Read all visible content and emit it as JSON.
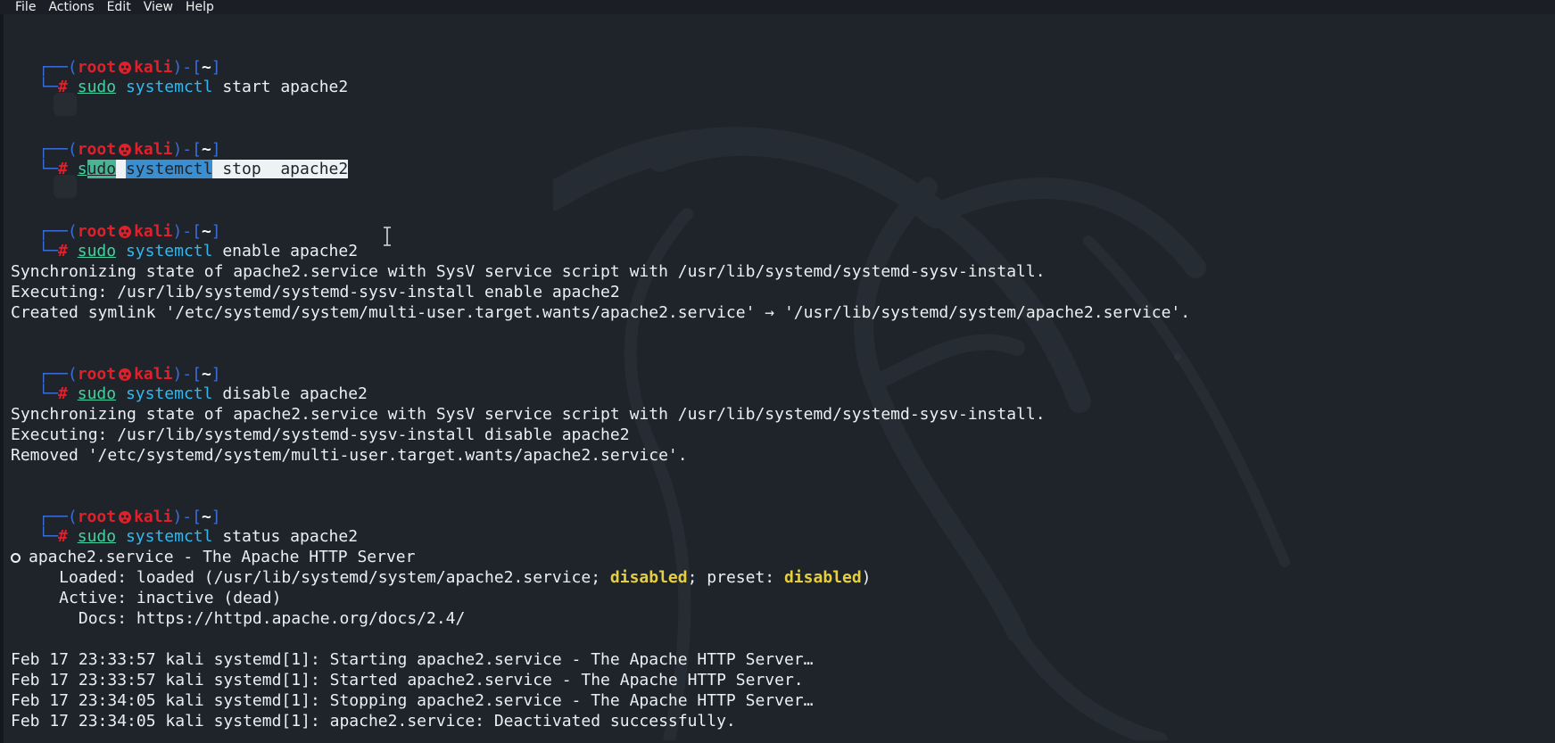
{
  "menu": [
    "File",
    "Actions",
    "Edit",
    "View",
    "Help"
  ],
  "prompt": {
    "open": "┌──(",
    "user": "root",
    "host": "kali",
    "mid": ")-[",
    "dir": "~",
    "close": "]",
    "corner": "└─",
    "hash": "#"
  },
  "blocks": [
    {
      "sudo": "sudo",
      "systemctl": "systemctl",
      "args": " start apache2"
    },
    {
      "sudo_s": "s",
      "sudo_rest": "udo",
      "systemctl": "systemctl",
      "args": " stop  apache2"
    },
    {
      "sudo": "sudo",
      "systemctl": "systemctl",
      "args": " enable apache2"
    },
    {
      "sudo": "sudo",
      "systemctl": "systemctl",
      "args": " disable apache2"
    },
    {
      "sudo": "sudo",
      "systemctl": "systemctl",
      "args": " status apache2"
    }
  ],
  "enable_output": [
    "Synchronizing state of apache2.service with SysV service script with /usr/lib/systemd/systemd-sysv-install.",
    "Executing: /usr/lib/systemd/systemd-sysv-install enable apache2",
    "Created symlink '/etc/systemd/system/multi-user.target.wants/apache2.service' → '/usr/lib/systemd/system/apache2.service'."
  ],
  "disable_output": [
    "Synchronizing state of apache2.service with SysV service script with /usr/lib/systemd/systemd-sysv-install.",
    "Executing: /usr/lib/systemd/systemd-sysv-install disable apache2",
    "Removed '/etc/systemd/system/multi-user.target.wants/apache2.service'."
  ],
  "status": {
    "header": "apache2.service - The Apache HTTP Server",
    "loaded_pre": "     Loaded: loaded (/usr/lib/systemd/system/apache2.service; ",
    "loaded_state": "disabled",
    "loaded_mid": "; preset: ",
    "preset_state": "disabled",
    "loaded_end": ")",
    "active": "     Active: inactive (dead)",
    "docs": "       Docs: https://httpd.apache.org/docs/2.4/"
  },
  "log": [
    "Feb 17 23:33:57 kali systemd[1]: Starting apache2.service - The Apache HTTP Server…",
    "Feb 17 23:33:57 kali systemd[1]: Started apache2.service - The Apache HTTP Server.",
    "Feb 17 23:34:05 kali systemd[1]: Stopping apache2.service - The Apache HTTP Server…",
    "Feb 17 23:34:05 kali systemd[1]: apache2.service: Deactivated successfully."
  ],
  "colors": {
    "background": "#1f242b",
    "prompt_frame": "#3b6dd8",
    "root_host": "#e0202a",
    "sudo": "#45d0a0",
    "systemctl": "#36b7ec",
    "highlight": "#e6cf3f"
  },
  "icons": [
    "kali-skull-icon",
    "text-cursor-icon",
    "dragon-watermark"
  ]
}
